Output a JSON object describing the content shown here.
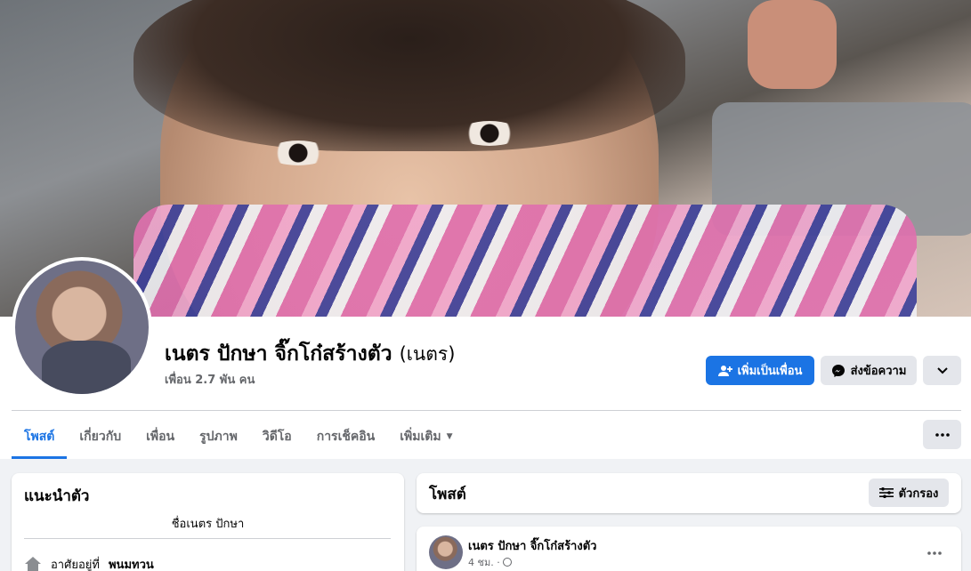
{
  "profile": {
    "name": "เนตร ปักษา จิ๊กโก๋สร้างตัว",
    "alternate_name": "(เนตร)",
    "friends_count": "เพื่อน 2.7 พัน คน"
  },
  "actions": {
    "add_friend_label": "เพิ่มเป็นเพื่อน",
    "message_label": "ส่งข้อความ",
    "more_icon": "chevron-down-icon",
    "overflow_icon": "ellipsis-icon"
  },
  "tabs": [
    {
      "label": "โพสต์",
      "active": true
    },
    {
      "label": "เกี่ยวกับ",
      "active": false
    },
    {
      "label": "เพื่อน",
      "active": false
    },
    {
      "label": "รูปภาพ",
      "active": false
    },
    {
      "label": "วิดีโอ",
      "active": false
    },
    {
      "label": "การเช็คอิน",
      "active": false
    },
    {
      "label": "เพิ่มเติม",
      "active": false
    }
  ],
  "intro": {
    "title": "แนะนำตัว",
    "bio": "ชื่อเนตร ปักษา",
    "lives_in_prefix": "อาศัยอยู่ที่",
    "lives_in_place": "พนมทวน"
  },
  "posts": {
    "title": "โพสต์",
    "filter_label": "ตัวกรอง",
    "first_post": {
      "author": "เนตร ปักษา จิ๊กโก๋สร้างตัว",
      "time": "4 ชม. ·"
    }
  },
  "colors": {
    "accent": "#1b74e4",
    "button_gray": "#e4e6eb",
    "page_bg": "#f0f2f5",
    "secondary_text": "#65676b"
  }
}
